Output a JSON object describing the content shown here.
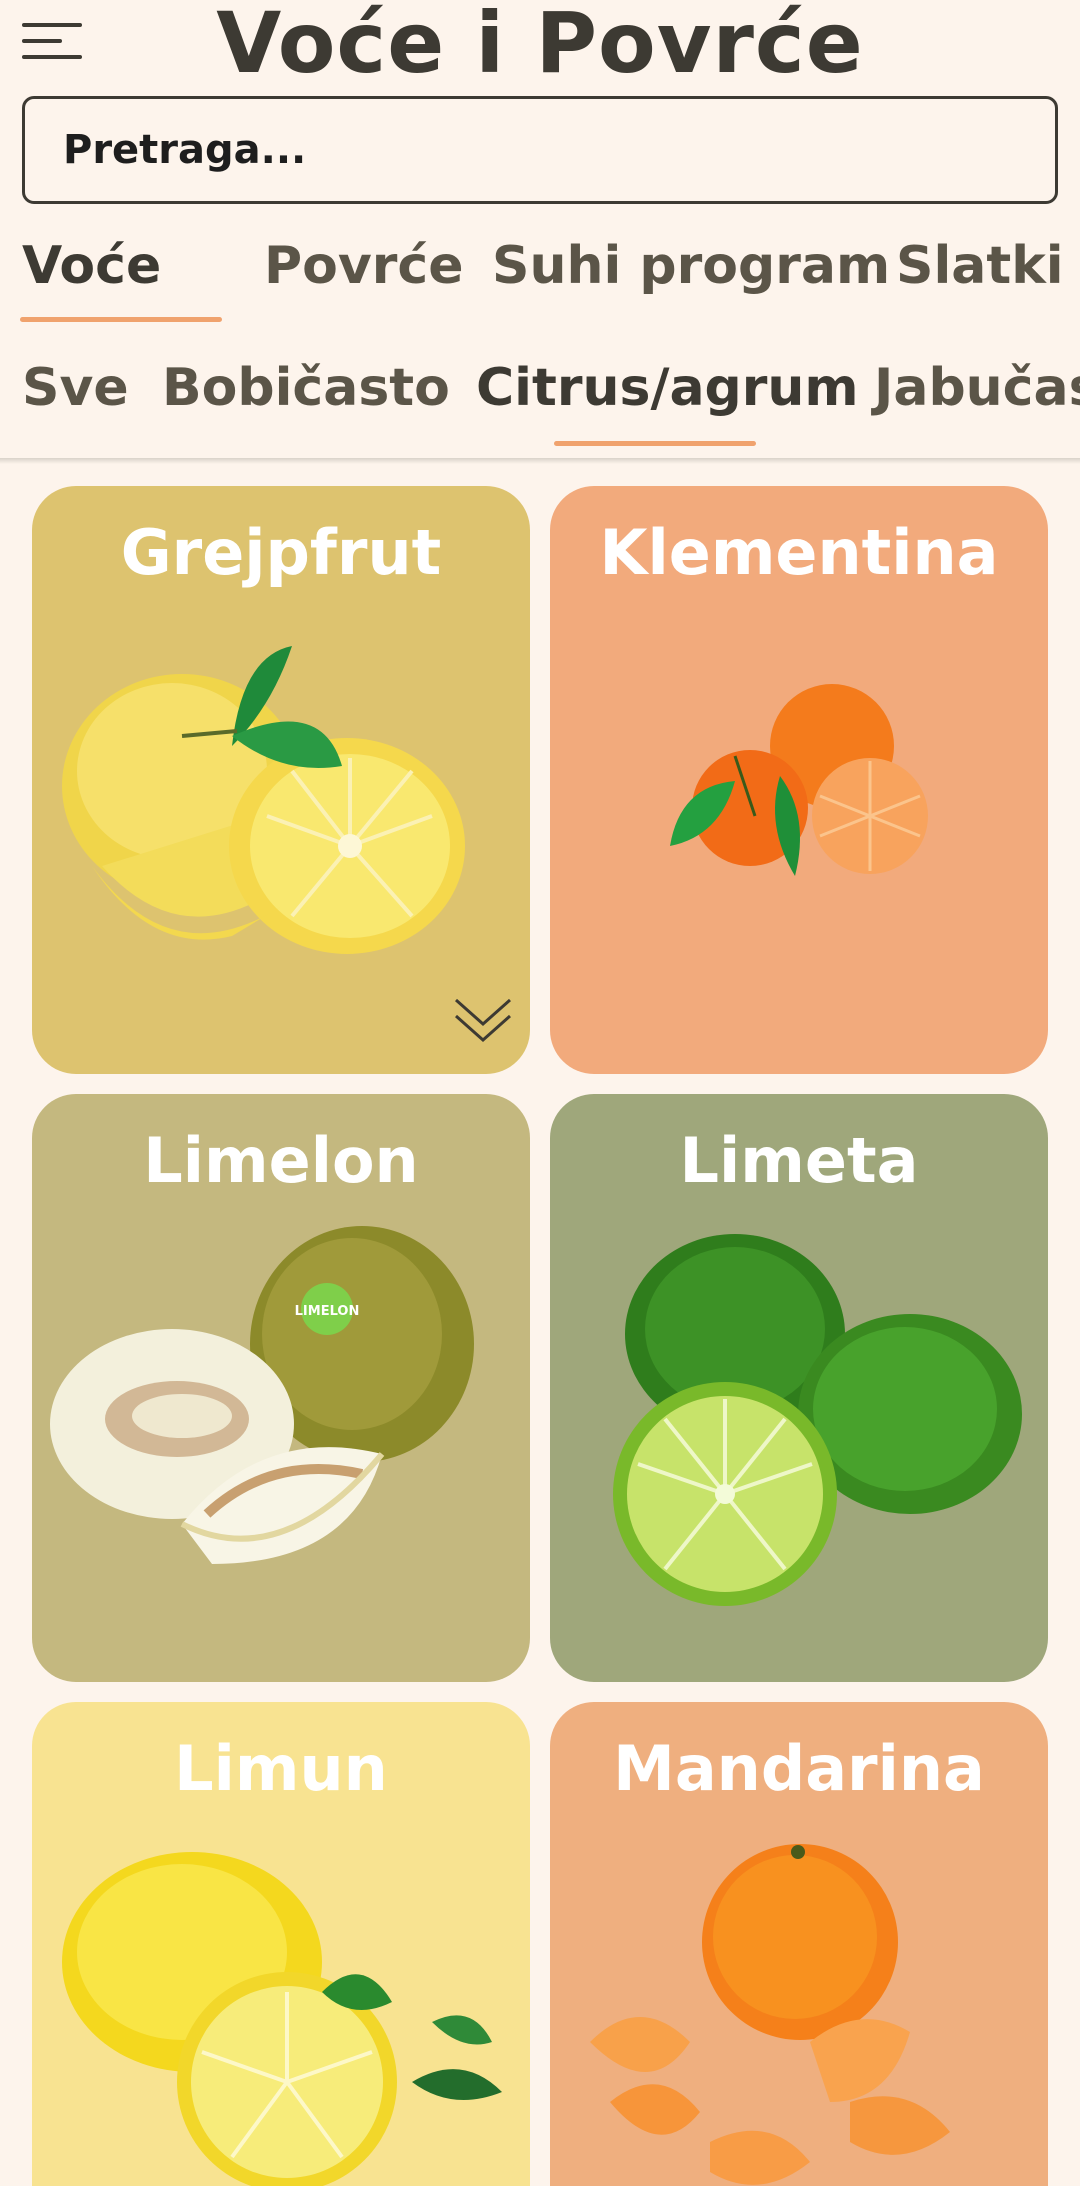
{
  "header": {
    "title": "Voće i Povrće",
    "menu_icon": "hamburger-menu-icon"
  },
  "search": {
    "placeholder": "Pretraga...",
    "value": ""
  },
  "tabs": [
    {
      "label": "Voće",
      "active": true
    },
    {
      "label": "Povrće",
      "active": false
    },
    {
      "label": "Suhi program",
      "active": false
    },
    {
      "label": "Slatki program",
      "active": false
    }
  ],
  "subtabs": [
    {
      "label": "Sve",
      "active": false
    },
    {
      "label": "Bobičasto",
      "active": false
    },
    {
      "label": "Citrus/agrum",
      "active": true
    },
    {
      "label": "Jabučasto",
      "active": false
    }
  ],
  "colors": {
    "background": "#fdf4ec",
    "accent_underline": "#f0a26d",
    "text": "#3d3a33"
  },
  "products": [
    {
      "name": "Grejpfrut",
      "color": "#ddc36f",
      "icon": "grapefruit-image"
    },
    {
      "name": "Klementina",
      "color": "#f2aa7c",
      "icon": "clementine-image"
    },
    {
      "name": "Limelon",
      "color": "#c4b87f",
      "icon": "limelon-image"
    },
    {
      "name": "Limeta",
      "color": "#9fa77b",
      "icon": "lime-image"
    },
    {
      "name": "Limun",
      "color": "#f8e391",
      "icon": "lemon-image"
    },
    {
      "name": "Mandarina",
      "color": "#efaf7f",
      "icon": "mandarin-image"
    }
  ]
}
